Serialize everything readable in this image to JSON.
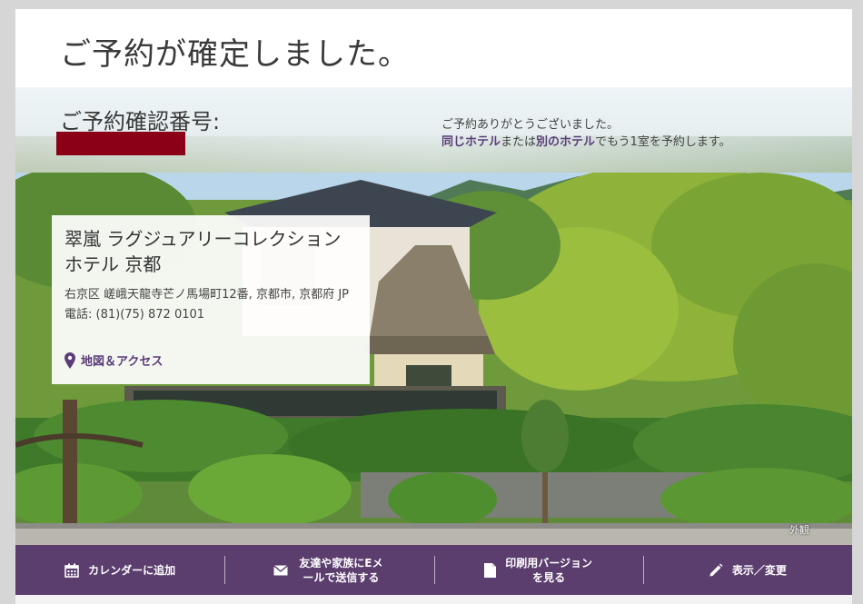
{
  "header": {
    "title": "ご予約が確定しました。"
  },
  "confirmation": {
    "label": "ご予約確認番号:",
    "number_color": "#8b0016",
    "thanks": "ご予約ありがとうございました。",
    "rebook_same": "同じホテル",
    "rebook_mid": "または",
    "rebook_other": "別のホテル",
    "rebook_end": "でもう1室を予約します。"
  },
  "hotel": {
    "name": "翠嵐 ラグジュアリーコレクションホテル 京都",
    "address": "右京区 嵯峨天龍寺芒ノ馬場町12番, 京都市, 京都府 JP",
    "phone": "電話: (81)(75) 872 0101",
    "map_link": "地図＆アクセス"
  },
  "image": {
    "caption": "外観"
  },
  "actions": [
    {
      "icon": "calendar-icon",
      "label": "カレンダーに追加"
    },
    {
      "icon": "envelope-icon",
      "label": "友達や家族にEメールで送信する"
    },
    {
      "icon": "document-icon",
      "label": "印刷用バージョンを見る"
    },
    {
      "icon": "pencil-icon",
      "label": "表示／変更"
    }
  ],
  "colors": {
    "accent": "#5b3d7a",
    "action_bar": "#5b3d6e",
    "confirmation_redacted": "#8b0016"
  }
}
